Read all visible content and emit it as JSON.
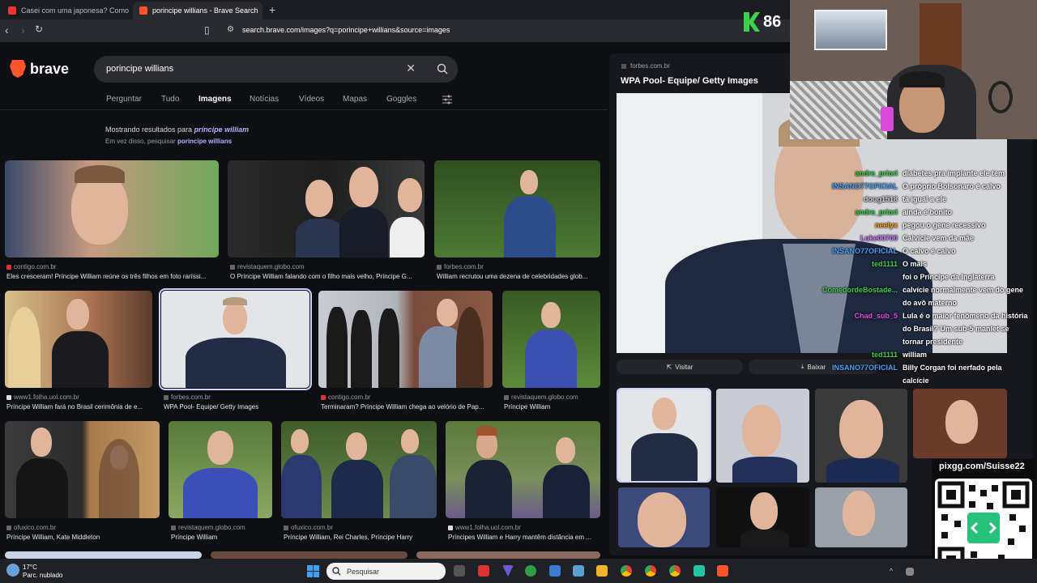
{
  "tabs": [
    {
      "label": "Casei com uma japonesa? Como",
      "favicon_color": "#e33"
    },
    {
      "label": "porincipe willians - Brave Search",
      "favicon_color": "#fb542b"
    }
  ],
  "address": {
    "url": "search.brave.com/images?q=porincipe+willians&source=images"
  },
  "brand": {
    "name": "brave"
  },
  "search": {
    "query": "porincipe willians"
  },
  "nav_tabs": [
    "Perguntar",
    "Tudo",
    "Imagens",
    "Notícias",
    "Vídeos",
    "Mapas",
    "Goggles"
  ],
  "correction": {
    "showing_prefix": "Mostrando resultados para ",
    "showing_term": "príncipe william",
    "instead_prefix": "Em vez disso, pesquisar ",
    "instead_term": "porincipe willians"
  },
  "results": [
    {
      "source": "contigo.com.br",
      "caption": "Eles cresceram! Príncipe William reúne os três filhos em foto raríssi..."
    },
    {
      "source": "revistaquem.globo.com",
      "caption": "O Príncipe William falando com o filho mais velho, Príncipe G..."
    },
    {
      "source": "forbes.com.br",
      "caption": "William recrutou uma dezena de celebridades glob..."
    },
    {
      "source": "www1.folha.uol.com.br",
      "caption": "Príncipe William fará no Brasil cerimônia de e..."
    },
    {
      "source": "forbes.com.br",
      "caption": "WPA Pool- Equipe/ Getty Images"
    },
    {
      "source": "contigo.com.br",
      "caption": "Terminaram? Príncipe William chega ao velório de Pap..."
    },
    {
      "source": "revistaquem.globo.com",
      "caption": "Príncipe William"
    },
    {
      "source": "ofuxico.com.br",
      "caption": "Príncipe William, Kate Middleton"
    },
    {
      "source": "revistaquem.globo.com",
      "caption": "Príncipe William"
    },
    {
      "source": "ofuxico.com.br",
      "caption": "Príncipe William, Rei Charles, Príncipe Harry"
    },
    {
      "source": "www1.folha.uol.com.br",
      "caption": "Príncipes William e Harry mantêm distância em ..."
    }
  ],
  "panel": {
    "source": "forbes.com.br",
    "title": "WPA Pool- Equipe/ Getty Images",
    "visit_label": "Visitar",
    "download_label": "Baixar"
  },
  "overlay": {
    "counter": "86",
    "qr_url": "pixgg.com/Suisse22"
  },
  "chat": [
    {
      "user": "andre_priori",
      "color": "#3bd14a",
      "msg": "diabetes pra implante ele tem"
    },
    {
      "user": "INSANO77OFICIAL",
      "color": "#4aa3ff",
      "msg": "O próprio Bolsonaro é calvo"
    },
    {
      "user": "doug1518",
      "color": "#cccccc",
      "msg": "tá igual a ele"
    },
    {
      "user": "andre_priori",
      "color": "#3bd14a",
      "msg": "ainda é bonito"
    },
    {
      "user": "neelyx",
      "color": "#ff9f1c",
      "msg": "pegou o gene recessivo"
    },
    {
      "user": "Luke00700",
      "color": "#c77dff",
      "msg": "Calvície vem da mãe"
    },
    {
      "user": "INSANO77OFICIAL",
      "color": "#4aa3ff",
      "msg": "O calvo é calvo"
    },
    {
      "user": "ted1111",
      "color": "#3bd14a",
      "msg": "O mais "
    },
    {
      "user": "",
      "color": "#ffffff",
      "msg": "foi o Príncipe da Inglaterra"
    },
    {
      "user": "ComedordeBostade...",
      "color": "#3bd14a",
      "msg": "calvície normalmente vem do gene"
    },
    {
      "user": "",
      "color": "#ffffff",
      "msg": "do avô materno"
    },
    {
      "user": "Chad_sub_5",
      "color": "#e84ae8",
      "msg": "Lula é o maior fenômeno da história"
    },
    {
      "user": "",
      "color": "#ffffff",
      "msg": "do Brasil? Um sub-5 manlet se"
    },
    {
      "user": "",
      "color": "#ffffff",
      "msg": "tornar presidente"
    },
    {
      "user": "ted1111",
      "color": "#3bd14a",
      "msg": "william"
    },
    {
      "user": "INSANO77OFICIAL",
      "color": "#4aa3ff",
      "msg": "Billy Corgan foi nerfado pela"
    },
    {
      "user": "",
      "color": "#ffffff",
      "msg": "calcície"
    }
  ],
  "taskbar": {
    "temperature": "17°C",
    "weather_desc": "Parc. nublado",
    "search_placeholder": "Pesquisar"
  }
}
